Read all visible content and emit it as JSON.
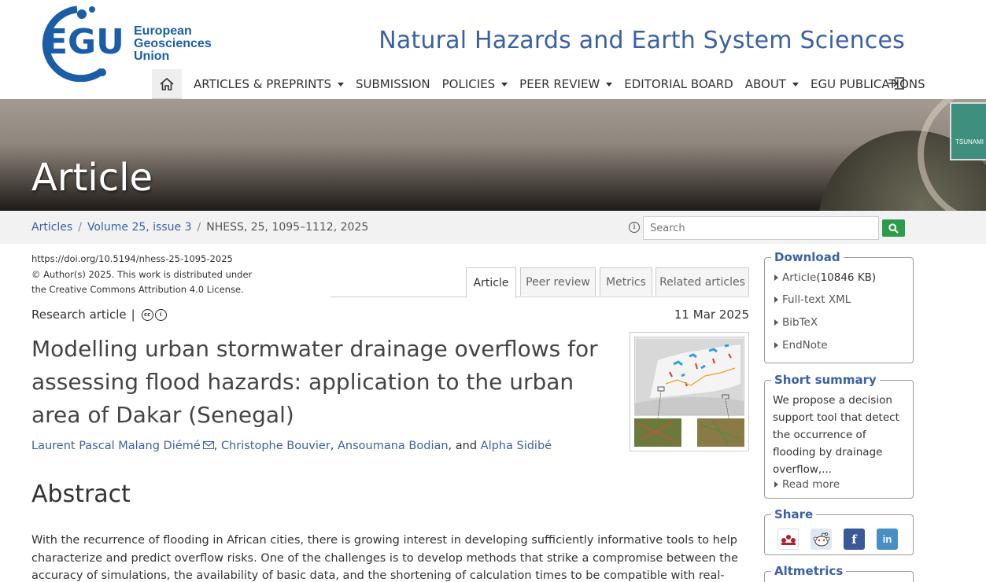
{
  "header": {
    "logo_mark": "EGU",
    "logo_line1": "European",
    "logo_line2": "Geosciences",
    "logo_line3": "Union",
    "journal_title": "Natural Hazards and Earth System Sciences"
  },
  "nav": {
    "items": [
      {
        "label": "ARTICLES & PREPRINTS",
        "dropdown": true
      },
      {
        "label": "SUBMISSION",
        "dropdown": false
      },
      {
        "label": "POLICIES",
        "dropdown": true
      },
      {
        "label": "PEER REVIEW",
        "dropdown": true
      },
      {
        "label": "EDITORIAL BOARD",
        "dropdown": false
      },
      {
        "label": "ABOUT",
        "dropdown": true
      },
      {
        "label": "EGU PUBLICATIONS",
        "dropdown": false
      }
    ]
  },
  "banner": {
    "title": "Article",
    "sign_text": "TSUNAMI"
  },
  "breadcrumb": {
    "articles": "Articles",
    "volume": "Volume 25, issue 3",
    "current": "NHESS, 25, 1095–1112, 2025"
  },
  "search": {
    "placeholder": "Search"
  },
  "article": {
    "doi": "https://doi.org/10.5194/nhess-25-1095-2025",
    "license_line1": "© Author(s) 2025. This work is distributed under",
    "license_line2": "the Creative Commons Attribution 4.0 License.",
    "type": "Research article",
    "type_sep": "|",
    "date": "11 Mar 2025",
    "title": "Modelling urban stormwater drainage overflows for assessing flood hazards: application to the urban area of Dakar (Senegal)",
    "authors": [
      "Laurent Pascal Malang Diémé",
      "Christophe Bouvier",
      "Ansoumana Bodian",
      "Alpha Sidibé"
    ],
    "author_sep": ",",
    "author_and": ", and",
    "abstract_heading": "Abstract",
    "abstract_text": "With the recurrence of flooding in African cities, there is growing interest in developing sufficiently informative tools to help characterize and predict overflow risks. One of the challenges is to develop methods that strike a compromise between the accuracy of simulations, the availability of basic data, and the shortening of calculation times to be compatible with real-time"
  },
  "tabs": [
    {
      "label": "Article",
      "active": true
    },
    {
      "label": "Peer review",
      "active": false
    },
    {
      "label": "Metrics",
      "active": false
    },
    {
      "label": "Related articles",
      "active": false
    }
  ],
  "sidebar": {
    "download": {
      "title": "Download",
      "article_label": "Article",
      "article_size": " (10846 KB)",
      "links": [
        "Full-text XML",
        "BibTeX",
        "EndNote"
      ]
    },
    "summary": {
      "title": "Short summary",
      "text": "We propose a decision support tool that detect the occurrence of flooding by drainage overflow,...",
      "read_more": "Read more"
    },
    "share": {
      "title": "Share",
      "icons": [
        "mendeley-icon",
        "reddit-icon",
        "facebook-icon",
        "linkedin-icon"
      ],
      "facebook_glyph": "f",
      "linkedin_glyph": "in"
    },
    "altmetrics": {
      "title": "Altmetrics"
    }
  },
  "colors": {
    "brand_blue": "#3b61a4",
    "search_green": "#2e9b4c",
    "facebook": "#3b5998",
    "linkedin": "#4a8fc4"
  }
}
